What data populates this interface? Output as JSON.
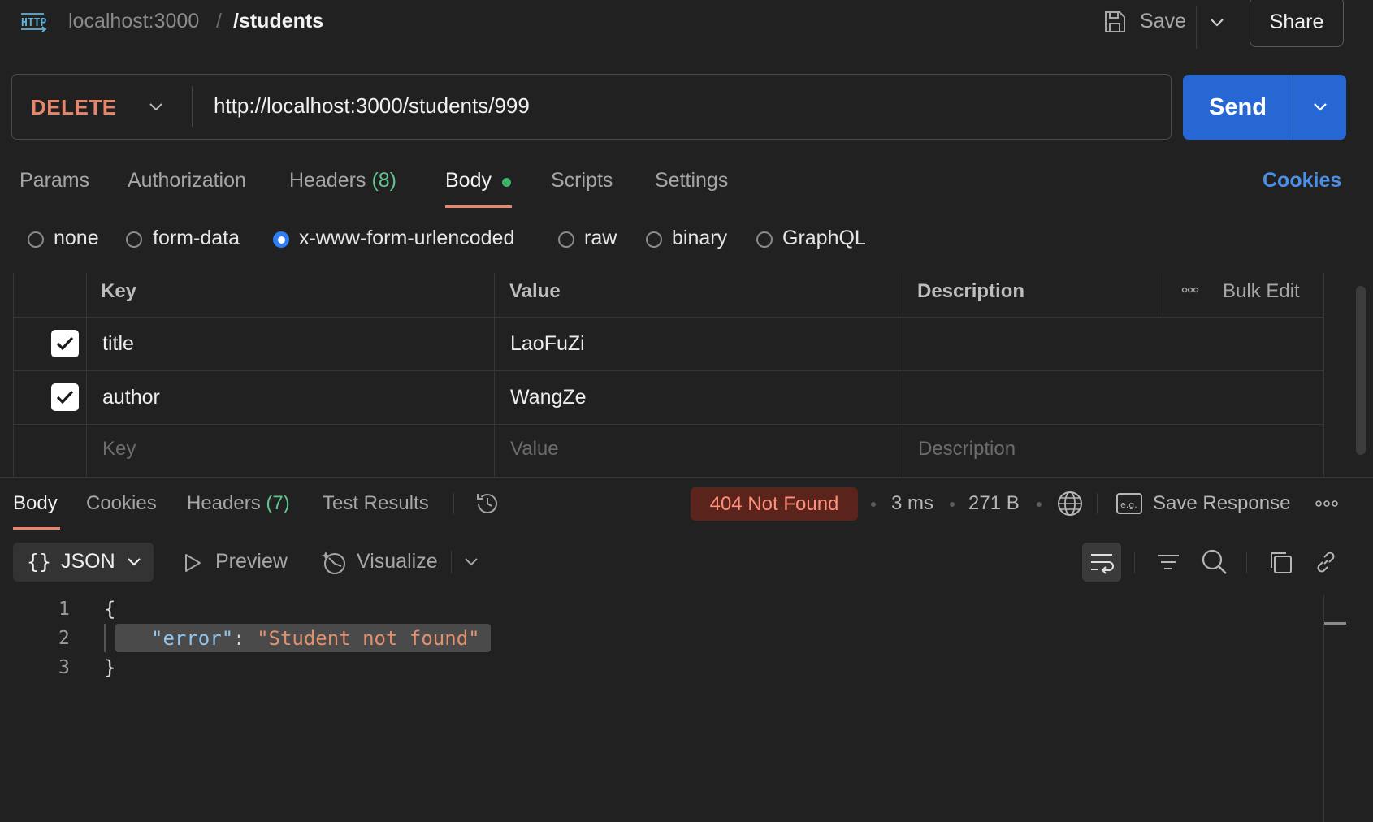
{
  "topbar": {
    "protocol_icon": "http-icon",
    "host": "localhost:3000",
    "separator": "/",
    "path": "/students",
    "save_label": "Save",
    "share_label": "Share"
  },
  "request": {
    "method": "DELETE",
    "url": "http://localhost:3000/students/999",
    "send_label": "Send"
  },
  "tabs": {
    "params": "Params",
    "authorization": "Authorization",
    "headers": "Headers",
    "headers_count": "(8)",
    "body": "Body",
    "scripts": "Scripts",
    "settings": "Settings",
    "cookies": "Cookies",
    "active": "Body"
  },
  "body_types": {
    "options": [
      "none",
      "form-data",
      "x-www-form-urlencoded",
      "raw",
      "binary",
      "GraphQL"
    ],
    "selected": "x-www-form-urlencoded"
  },
  "params_table": {
    "headers": {
      "key": "Key",
      "value": "Value",
      "description": "Description",
      "bulk_edit": "Bulk Edit"
    },
    "rows": [
      {
        "checked": true,
        "key": "title",
        "value": "LaoFuZi",
        "description": ""
      },
      {
        "checked": true,
        "key": "author",
        "value": "WangZe",
        "description": ""
      }
    ],
    "placeholder": {
      "key": "Key",
      "value": "Value",
      "description": "Description"
    }
  },
  "response": {
    "tabs": {
      "body": "Body",
      "cookies": "Cookies",
      "headers": "Headers",
      "headers_count": "(7)",
      "test_results": "Test Results",
      "active": "Body"
    },
    "status": "404 Not Found",
    "time": "3 ms",
    "size": "271 B",
    "save_response": "Save Response",
    "format": "JSON",
    "preview": "Preview",
    "visualize": "Visualize",
    "code": {
      "line_numbers": [
        "1",
        "2",
        "3"
      ],
      "open_brace": "{",
      "key": "\"error\"",
      "colon": ":",
      "value": "\"Student not found\"",
      "close_brace": "}"
    }
  },
  "colors": {
    "background": "#212121",
    "method_delete": "#e8866b",
    "send_blue": "#2667d3",
    "link_blue": "#4a8fe8",
    "count_green": "#62c38d",
    "status_error_bg": "#5a231b",
    "status_error_text": "#ff8f7a",
    "json_key": "#8fc4ec",
    "json_string": "#e2906e"
  }
}
